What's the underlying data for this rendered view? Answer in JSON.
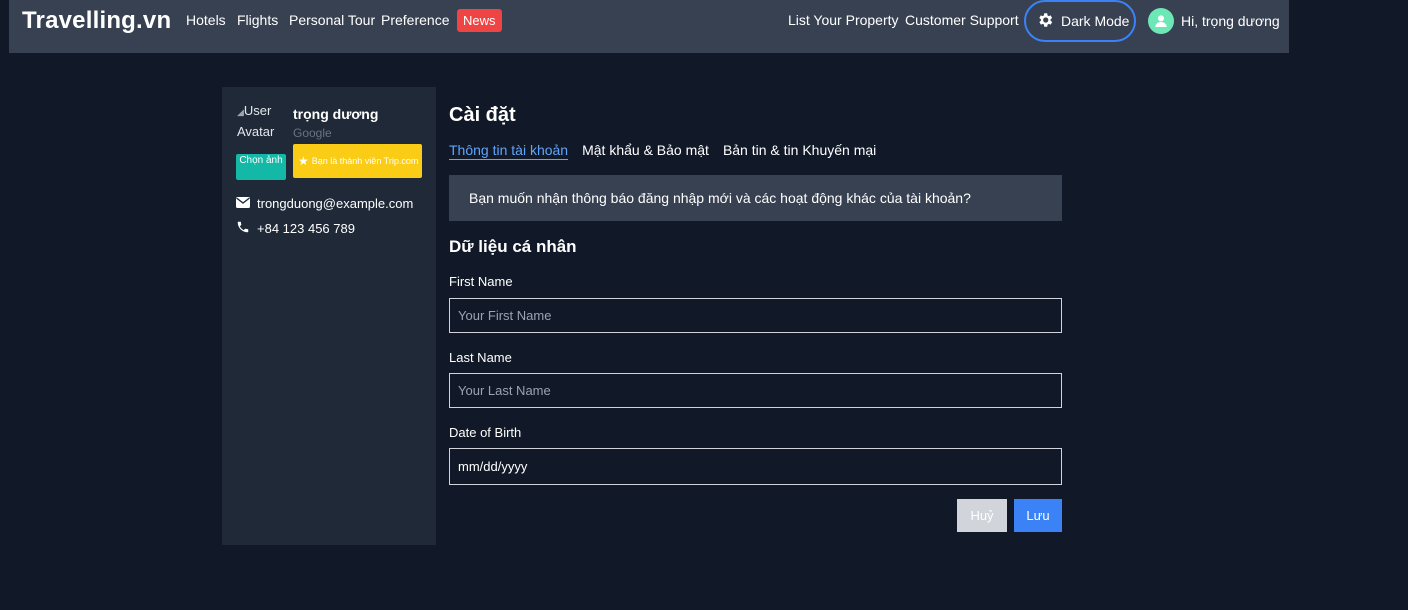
{
  "navbar": {
    "logo": "Travelling.vn",
    "links": [
      "Hotels",
      "Flights",
      "Personal Tour",
      "Preference"
    ],
    "news_label": "News",
    "list_property": "List Your Property",
    "customer_support": "Customer Support",
    "dark_mode_label": "Dark Mode",
    "greeting": "Hi, trọng dương"
  },
  "sidebar": {
    "avatar_alt": "User Avatar",
    "name": "trọng dương",
    "provider": "Google",
    "choose_photo": "Chọn ảnh",
    "member_badge": "Bạn là thành viên Trip.com",
    "email": "trongduong@example.com",
    "phone": "+84 123 456 789"
  },
  "main": {
    "title": "Cài đặt",
    "tabs": [
      {
        "label": "Thông tin tài khoản",
        "active": true
      },
      {
        "label": "Mật khẩu & Bảo mật",
        "active": false
      },
      {
        "label": "Bản tin & tin Khuyến mại",
        "active": false
      }
    ],
    "notice": "Bạn muốn nhận thông báo đăng nhập mới và các hoạt động khác của tài khoản?",
    "section_title": "Dữ liệu cá nhân",
    "first_name": {
      "label": "First Name",
      "placeholder": "Your First Name",
      "value": ""
    },
    "last_name": {
      "label": "Last Name",
      "placeholder": "Your Last Name",
      "value": ""
    },
    "dob": {
      "label": "Date of Birth",
      "value": "mm/dd/yyyy"
    },
    "cancel_label": "Huỷ",
    "save_label": "Lưu"
  },
  "colors": {
    "background": "#111827",
    "navbar": "#374151",
    "sidebar": "#1f2937",
    "news": "#ef4444",
    "accent": "#3b82f6",
    "teal": "#14b8a6",
    "yellow": "#facc15"
  }
}
